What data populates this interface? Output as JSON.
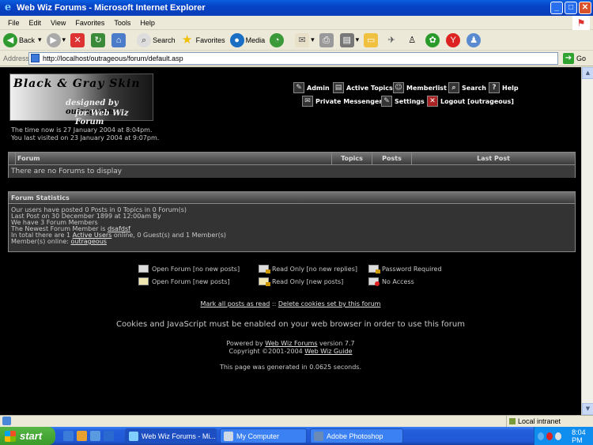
{
  "window": {
    "title": "Web Wiz Forums - Microsoft Internet Explorer"
  },
  "menu": [
    "File",
    "Edit",
    "View",
    "Favorites",
    "Tools",
    "Help"
  ],
  "toolbar": {
    "back": "Back",
    "search": "Search",
    "favorites": "Favorites",
    "media": "Media"
  },
  "address": {
    "label": "Address",
    "url": "http://localhost/outrageous/forum/default.asp",
    "go": "Go"
  },
  "logo": {
    "line1": "Black & Gray Skin",
    "line2_a": "designed by ",
    "line2_b": "outrageous",
    "line3": "for Web Wiz Forum"
  },
  "nav": {
    "admin": "Admin",
    "active_topics": "Active Topics",
    "memberlist": "Memberlist",
    "search": "Search",
    "help": "Help",
    "pm": "Private Messenger",
    "settings": "Settings",
    "logout": "Logout [outrageous]"
  },
  "time_info": {
    "now": "The time now is 27 January 2004 at 8:04pm.",
    "last_visit": "You last visited on 23 January 2004 at 9:07pm."
  },
  "forum_table": {
    "headers": [
      "Forum",
      "Topics",
      "Posts",
      "Last Post"
    ],
    "empty": "There are no Forums to display"
  },
  "stats": {
    "header": "Forum Statistics",
    "line1": "Our users have posted 0 Posts in 0 Topics in 0 Forum(s)",
    "line2": "Last Post on 30 December 1899 at 12:00am By",
    "line3": "We have 3 Forum Members",
    "line4_pre": "The Newest Forum Member is ",
    "line4_link": "dsafdsf",
    "line5_pre": "In total there are 1 ",
    "line5_link": "Active Users",
    "line5_post": " online, 0 Guest(s) and 1 Member(s)",
    "line6_pre": "Member(s) online: ",
    "line6_link": "outrageous"
  },
  "legend": {
    "open_no_new": "Open Forum [no new posts]",
    "open_new": "Open Forum [new posts]",
    "ro_no_new": "Read Only [no new replies]",
    "ro_new": "Read Only [new posts]",
    "password": "Password Required",
    "no_access": "No Access"
  },
  "links": {
    "mark_read": "Mark all posts as read",
    "sep": " :: ",
    "delete_cookies": "Delete cookies set by this forum"
  },
  "cookies_note": "Cookies and JavaScript must be enabled on your web browser in order to use this forum",
  "credits": {
    "powered_pre": "Powered by ",
    "powered_link": "Web Wiz Forums",
    "powered_post": " version 7.7",
    "copy_pre": "Copyright ©2001-2004 ",
    "copy_link": "Web Wiz Guide"
  },
  "generated": "This page was generated in 0.0625 seconds.",
  "status": {
    "zone": "Local intranet"
  },
  "taskbar": {
    "start": "start",
    "tasks": [
      "Web Wiz Forums - Mi...",
      "My Computer",
      "Adobe Photoshop"
    ],
    "clock": "8:04 PM"
  }
}
